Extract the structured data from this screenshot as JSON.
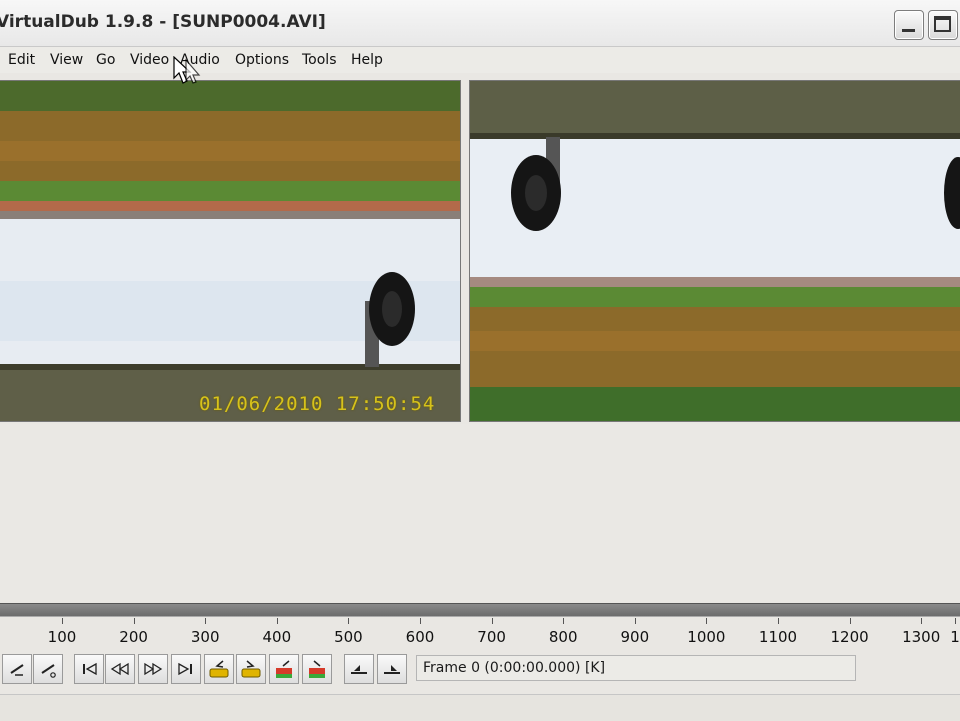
{
  "window": {
    "title": "VirtualDub 1.9.8 - [SUNP0004.AVI]",
    "controls": [
      "minimize",
      "maximize"
    ]
  },
  "menu": [
    {
      "label": "Edit"
    },
    {
      "label": "View"
    },
    {
      "label": "Go"
    },
    {
      "label": "Video"
    },
    {
      "label": "Audio"
    },
    {
      "label": "Options"
    },
    {
      "label": "Tools"
    },
    {
      "label": "Help"
    }
  ],
  "video": {
    "input_pane": {
      "name": "input-video-pane",
      "timestamp": "01/06/2010 17:50:54"
    },
    "output_pane": {
      "name": "output-video-pane"
    }
  },
  "timeline": {
    "tick_labels": [
      "100",
      "200",
      "300",
      "400",
      "500",
      "600",
      "700",
      "800",
      "900",
      "1000",
      "1100",
      "1200",
      "1300",
      "1"
    ],
    "position_fraction": 0
  },
  "toolbar": {
    "buttons": [
      {
        "name": "stop-button",
        "icon": "play-input-icon"
      },
      {
        "name": "play-output-button",
        "icon": "play-output-icon"
      },
      {
        "name": "go-start-button",
        "icon": "go-start-icon"
      },
      {
        "name": "prev-frame-button",
        "icon": "rewind-icon"
      },
      {
        "name": "next-frame-button",
        "icon": "fast-forward-icon"
      },
      {
        "name": "go-end-button",
        "icon": "go-end-icon"
      },
      {
        "name": "prev-keyframe-button",
        "icon": "prev-keyframe-icon"
      },
      {
        "name": "next-keyframe-button",
        "icon": "next-keyframe-icon"
      },
      {
        "name": "prev-scene-button",
        "icon": "prev-scene-icon"
      },
      {
        "name": "next-scene-button",
        "icon": "next-scene-icon"
      },
      {
        "name": "mark-in-button",
        "icon": "mark-in-icon"
      },
      {
        "name": "mark-out-button",
        "icon": "mark-out-icon"
      }
    ],
    "frame_status": "Frame 0 (0:00:00.000) [K]"
  },
  "colors": {
    "timestamp": "#d7c21b",
    "keyframe_icon": "#e0b400",
    "scene_icon_red": "#d63a2a",
    "scene_icon_green": "#3aa83a"
  }
}
